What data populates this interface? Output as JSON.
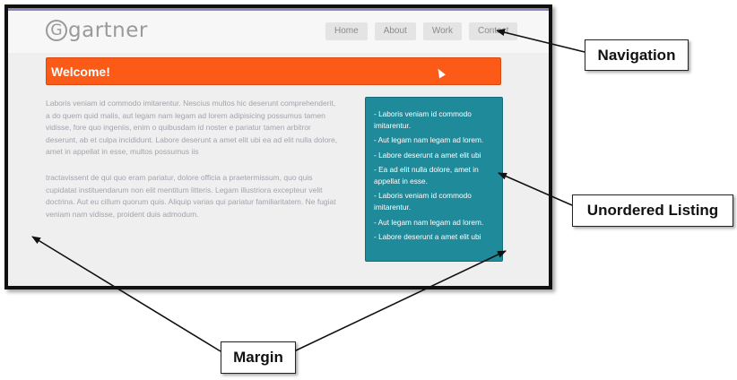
{
  "site": {
    "logo_mark": "G",
    "logo_text": "gartner",
    "nav": [
      "Home",
      "About",
      "Work",
      "Contact"
    ],
    "banner_title": "Welcome!",
    "paragraphs": [
      "Laboris veniam id commodo imitarentur. Nescius multos hic deserunt comprehenderit, a do quem quid malis, aut legam nam legam ad lorem adipisicing possumus tamen vidisse, fore quo ingeniis, enim o quibusdam id noster e pariatur tamen arbitror deserunt, ab et culpa incididunt. Labore deserunt a amet elit ubi ea ad elit nulla dolore, amet in appellat in esse, multos possumus iis",
      "tractavissent de qui quo eram pariatur, dolore officia a praetermissum, quo quis cupidatat instituendarum non elit mentitum litteris. Legam illustriora excepteur velit doctrina. Aut eu cillum quorum quis. Aliquip varias qui pariatur familiaritatem. Ne fugiat veniam nam vidisse, proident duis admodum."
    ],
    "list_items": [
      "- Laboris veniam id commodo imitarentur.",
      "- Aut legam nam legam ad lorem.",
      "- Labore deserunt a amet elit ubi",
      "- Ea ad elit nulla dolore, amet in appellat in esse.",
      "- Laboris veniam id commodo imitarentur.",
      "- Aut legam nam legam ad lorem.",
      "- Labore deserunt a amet elit ubi"
    ]
  },
  "annotations": {
    "navigation": "Navigation",
    "unordered_listing": "Unordered Listing",
    "margin": "Margin"
  },
  "colors": {
    "banner": "#fb5a17",
    "sidebox": "#1f8a9a",
    "frame_border": "#111111"
  }
}
